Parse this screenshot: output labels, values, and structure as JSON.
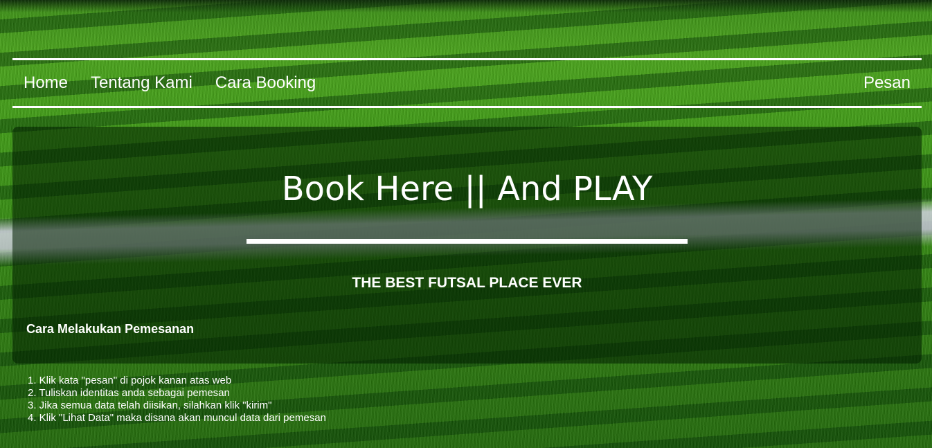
{
  "nav": {
    "items": [
      {
        "label": "Home"
      },
      {
        "label": "Tentang Kami"
      },
      {
        "label": "Cara Booking"
      }
    ],
    "right_item": {
      "label": "Pesan"
    }
  },
  "hero": {
    "title": "Book Here || And PLAY",
    "subtitle": "THE BEST FUTSAL PLACE EVER",
    "steps_heading": "Cara Melakukan Pemesanan"
  },
  "steps": [
    "1. Klik kata \"pesan\" di pojok kanan atas web",
    "2. Tuliskan identitas anda sebagai pemesan",
    "3. Jika semua data telah diisikan, silahkan klik \"kirim\"",
    "4. Klik \"Lihat Data\" maka disana akan muncul data dari pemesan"
  ],
  "colors": {
    "text": "#ffffff",
    "grass": "#3f9a16",
    "panel": "rgba(0,30,0,0.55)"
  }
}
